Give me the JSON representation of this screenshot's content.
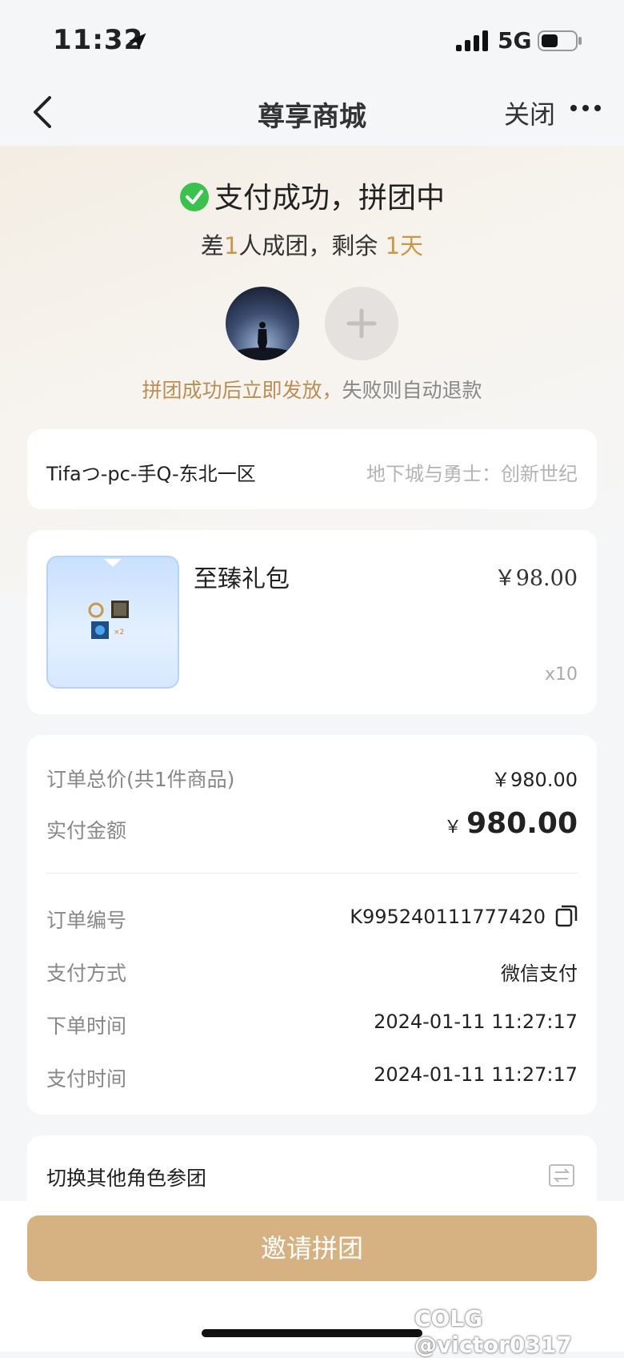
{
  "status_bar": {
    "time": "11:32",
    "network": "5G"
  },
  "nav": {
    "title": "尊享商城",
    "close_label": "关闭"
  },
  "hero": {
    "status_text": "支付成功，拼团中",
    "sub_prefix": "差",
    "sub_count": "1",
    "sub_middle": "人成团，剩余 ",
    "sub_days": "1天",
    "hint_gold": "拼团成功后立即发放，",
    "hint_rest": "失败则自动退款"
  },
  "role_card": {
    "role": "Tifaつ-pc-手Q-东北一区",
    "game": "地下城与勇士：创新世纪"
  },
  "item_card": {
    "name": "至臻礼包",
    "price": "￥98.00",
    "quantity": "x10",
    "thumb_badge": "×2"
  },
  "order": {
    "total_label": "订单总价(共1件商品)",
    "total_value": "￥980.00",
    "paid_label": "实付金额",
    "paid_currency": "￥",
    "paid_value": "980.00",
    "order_no_label": "订单编号",
    "order_no_value": "K995240111777420",
    "pay_method_label": "支付方式",
    "pay_method_value": "微信支付",
    "order_time_label": "下单时间",
    "order_time_value": "2024-01-11 11:27:17",
    "pay_time_label": "支付时间",
    "pay_time_value": "2024-01-11 11:27:17"
  },
  "switch_role": {
    "label": "切换其他角色参团"
  },
  "footer": {
    "invite_label": "邀请拼团",
    "watermark": "COLG @victor0317"
  },
  "colors": {
    "accent_gold": "#c9974c",
    "button_gold": "#d6b283",
    "success_green": "#3cc14f"
  },
  "icons": [
    "location-arrow-icon",
    "signal-icon",
    "battery-icon",
    "back-chevron-icon",
    "more-dots-icon",
    "check-circle-icon",
    "plus-icon",
    "copy-icon",
    "switch-icon"
  ]
}
